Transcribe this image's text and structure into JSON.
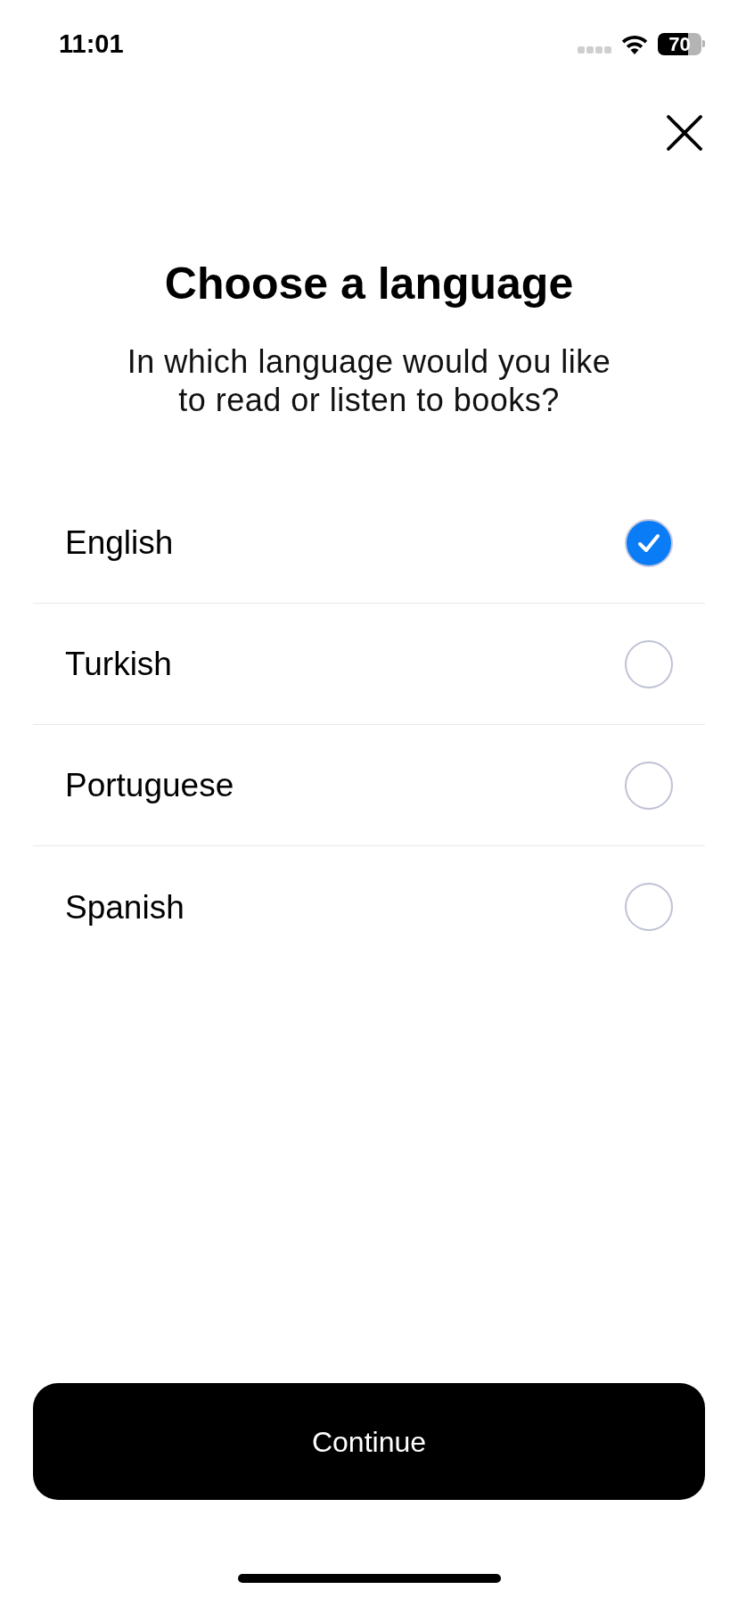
{
  "status_bar": {
    "time": "11:01",
    "battery": "70"
  },
  "title": "Choose a language",
  "subtitle": "In which language would you like to read or listen to books?",
  "languages": [
    {
      "label": "English",
      "selected": true
    },
    {
      "label": "Turkish",
      "selected": false
    },
    {
      "label": "Portuguese",
      "selected": false
    },
    {
      "label": "Spanish",
      "selected": false
    }
  ],
  "continue_button": {
    "label": "Continue"
  }
}
